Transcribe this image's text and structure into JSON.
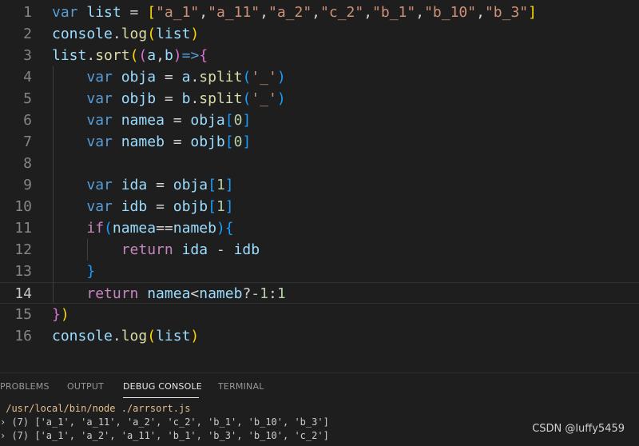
{
  "colors": {
    "background": "#1e1e1e",
    "keyword": "#569cd6",
    "variable": "#9cdcfe",
    "function": "#dcdcaa",
    "string": "#ce9178",
    "number": "#b5cea8",
    "control": "#c586c0",
    "text": "#d4d4d4",
    "bracket_yellow": "#ffd700",
    "bracket_pink": "#da70d6",
    "bracket_blue": "#179fff",
    "line_number": "#858585"
  },
  "editor": {
    "current_line": 14,
    "lines": [
      {
        "num": "1",
        "tokens": [
          [
            "var ",
            "keyword"
          ],
          [
            "list",
            "variable"
          ],
          [
            " = ",
            "text"
          ],
          [
            "[",
            "bracket_yellow"
          ],
          [
            "\"a_1\"",
            "string"
          ],
          [
            ",",
            "text"
          ],
          [
            "\"a_11\"",
            "string"
          ],
          [
            ",",
            "text"
          ],
          [
            "\"a_2\"",
            "string"
          ],
          [
            ",",
            "text"
          ],
          [
            "\"c_2\"",
            "string"
          ],
          [
            ",",
            "text"
          ],
          [
            "\"b_1\"",
            "string"
          ],
          [
            ",",
            "text"
          ],
          [
            "\"b_10\"",
            "string"
          ],
          [
            ",",
            "text"
          ],
          [
            "\"b_3\"",
            "string"
          ],
          [
            "]",
            "bracket_yellow"
          ]
        ]
      },
      {
        "num": "2",
        "tokens": [
          [
            "console",
            "variable"
          ],
          [
            ".",
            "text"
          ],
          [
            "log",
            "function"
          ],
          [
            "(",
            "bracket_yellow"
          ],
          [
            "list",
            "variable"
          ],
          [
            ")",
            "bracket_yellow"
          ]
        ]
      },
      {
        "num": "3",
        "tokens": [
          [
            "list",
            "variable"
          ],
          [
            ".",
            "text"
          ],
          [
            "sort",
            "function"
          ],
          [
            "(",
            "bracket_yellow"
          ],
          [
            "(",
            "bracket_pink"
          ],
          [
            "a",
            "variable"
          ],
          [
            ",",
            "text"
          ],
          [
            "b",
            "variable"
          ],
          [
            ")",
            "bracket_pink"
          ],
          [
            "=>",
            "keyword"
          ],
          [
            "{",
            "bracket_pink"
          ]
        ]
      },
      {
        "num": "4",
        "tokens": [
          [
            "    ",
            "text"
          ],
          [
            "var ",
            "keyword"
          ],
          [
            "obja",
            "variable"
          ],
          [
            " = ",
            "text"
          ],
          [
            "a",
            "variable"
          ],
          [
            ".",
            "text"
          ],
          [
            "split",
            "function"
          ],
          [
            "(",
            "bracket_blue"
          ],
          [
            "'_'",
            "string"
          ],
          [
            ")",
            "bracket_blue"
          ]
        ]
      },
      {
        "num": "5",
        "tokens": [
          [
            "    ",
            "text"
          ],
          [
            "var ",
            "keyword"
          ],
          [
            "objb",
            "variable"
          ],
          [
            " = ",
            "text"
          ],
          [
            "b",
            "variable"
          ],
          [
            ".",
            "text"
          ],
          [
            "split",
            "function"
          ],
          [
            "(",
            "bracket_blue"
          ],
          [
            "'_'",
            "string"
          ],
          [
            ")",
            "bracket_blue"
          ]
        ]
      },
      {
        "num": "6",
        "tokens": [
          [
            "    ",
            "text"
          ],
          [
            "var ",
            "keyword"
          ],
          [
            "namea",
            "variable"
          ],
          [
            " = ",
            "text"
          ],
          [
            "obja",
            "variable"
          ],
          [
            "[",
            "bracket_blue"
          ],
          [
            "0",
            "number"
          ],
          [
            "]",
            "bracket_blue"
          ]
        ]
      },
      {
        "num": "7",
        "tokens": [
          [
            "    ",
            "text"
          ],
          [
            "var ",
            "keyword"
          ],
          [
            "nameb",
            "variable"
          ],
          [
            " = ",
            "text"
          ],
          [
            "objb",
            "variable"
          ],
          [
            "[",
            "bracket_blue"
          ],
          [
            "0",
            "number"
          ],
          [
            "]",
            "bracket_blue"
          ]
        ]
      },
      {
        "num": "8",
        "tokens": []
      },
      {
        "num": "9",
        "tokens": [
          [
            "    ",
            "text"
          ],
          [
            "var ",
            "keyword"
          ],
          [
            "ida",
            "variable"
          ],
          [
            " = ",
            "text"
          ],
          [
            "obja",
            "variable"
          ],
          [
            "[",
            "bracket_blue"
          ],
          [
            "1",
            "number"
          ],
          [
            "]",
            "bracket_blue"
          ]
        ]
      },
      {
        "num": "10",
        "tokens": [
          [
            "    ",
            "text"
          ],
          [
            "var ",
            "keyword"
          ],
          [
            "idb",
            "variable"
          ],
          [
            " = ",
            "text"
          ],
          [
            "objb",
            "variable"
          ],
          [
            "[",
            "bracket_blue"
          ],
          [
            "1",
            "number"
          ],
          [
            "]",
            "bracket_blue"
          ]
        ]
      },
      {
        "num": "11",
        "tokens": [
          [
            "    ",
            "text"
          ],
          [
            "if",
            "control"
          ],
          [
            "(",
            "bracket_blue"
          ],
          [
            "namea",
            "variable"
          ],
          [
            "==",
            "text"
          ],
          [
            "nameb",
            "variable"
          ],
          [
            ")",
            "bracket_blue"
          ],
          [
            "{",
            "bracket_blue"
          ]
        ]
      },
      {
        "num": "12",
        "tokens": [
          [
            "        ",
            "text"
          ],
          [
            "return ",
            "control"
          ],
          [
            "ida",
            "variable"
          ],
          [
            " - ",
            "text"
          ],
          [
            "idb",
            "variable"
          ]
        ]
      },
      {
        "num": "13",
        "tokens": [
          [
            "    ",
            "text"
          ],
          [
            "}",
            "bracket_blue"
          ]
        ]
      },
      {
        "num": "14",
        "tokens": [
          [
            "    ",
            "text"
          ],
          [
            "return ",
            "control"
          ],
          [
            "namea",
            "variable"
          ],
          [
            "<",
            "text"
          ],
          [
            "nameb",
            "variable"
          ],
          [
            "?",
            "text"
          ],
          [
            "-1",
            "number"
          ],
          [
            ":",
            "text"
          ],
          [
            "1",
            "number"
          ]
        ]
      },
      {
        "num": "15",
        "tokens": [
          [
            "}",
            "bracket_pink"
          ],
          [
            ")",
            "bracket_yellow"
          ]
        ]
      },
      {
        "num": "16",
        "tokens": [
          [
            "console",
            "variable"
          ],
          [
            ".",
            "text"
          ],
          [
            "log",
            "function"
          ],
          [
            "(",
            "bracket_yellow"
          ],
          [
            "list",
            "variable"
          ],
          [
            ")",
            "bracket_yellow"
          ]
        ]
      }
    ]
  },
  "panel": {
    "tabs": [
      {
        "label": "PROBLEMS"
      },
      {
        "label": "OUTPUT"
      },
      {
        "label": "DEBUG CONSOLE",
        "active": true
      },
      {
        "label": "TERMINAL"
      }
    ],
    "console_lines": [
      {
        "text": " /usr/local/bin/node ./arrsort.js",
        "color": "#e2c08d"
      },
      {
        "text": "› (7) ['a_1', 'a_11', 'a_2', 'c_2', 'b_1', 'b_10', 'b_3']",
        "color": "#cccccc"
      },
      {
        "text": "› (7) ['a_1', 'a_2', 'a_11', 'b_1', 'b_3', 'b_10', 'c_2']",
        "color": "#cccccc"
      }
    ]
  },
  "watermark": "CSDN @luffy5459"
}
